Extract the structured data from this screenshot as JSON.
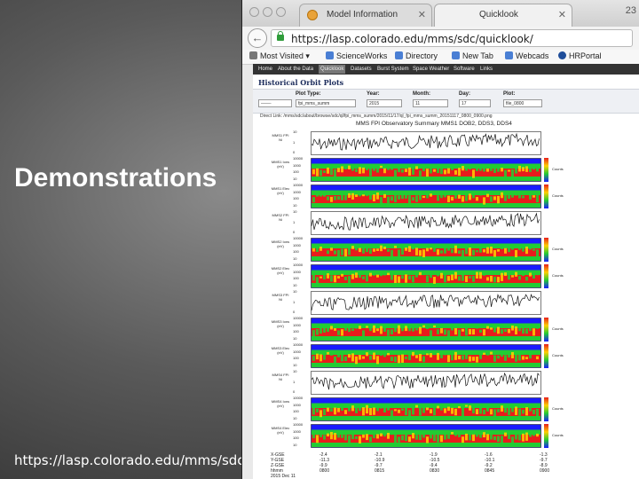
{
  "slide": {
    "title": "Demonstrations",
    "url": "https://lasp.colorado.edu/mms/sdc/"
  },
  "browser": {
    "tabs": [
      {
        "label": "Model Information",
        "active": false
      },
      {
        "label": "Quicklook",
        "active": true
      }
    ],
    "window_number": "23",
    "address": "https://lasp.colorado.edu/mms/sdc/quicklook/",
    "bookmarks": [
      {
        "label": "Most Visited",
        "icon": "gear-icon"
      },
      {
        "label": "ScienceWorks",
        "icon": "folder-icon"
      },
      {
        "label": "Directory",
        "icon": "folder-icon"
      },
      {
        "label": "New Tab",
        "icon": "folder-icon"
      },
      {
        "label": "Webcads",
        "icon": "folder-icon"
      },
      {
        "label": "HRPortal",
        "icon": "globe-icon"
      }
    ]
  },
  "site": {
    "menu": [
      "Home",
      "About the Data",
      "Quicklook",
      "Datasets",
      "Burst System",
      "Space Weather",
      "Software",
      "Links"
    ],
    "active_menu": "Quicklook",
    "section_title": "Historical Orbit Plots",
    "form": {
      "plot_type_label": "Plot Type:",
      "plot_type_value": "fpi_mms_summ",
      "observatory_value": "——-",
      "year_label": "Year:",
      "year_value": "2015",
      "month_label": "Month:",
      "month_value": "11",
      "day_label": "Day:",
      "day_value": "17",
      "plot_label": "Plot:",
      "plot_value": "file_0800"
    },
    "direct_link": "Direct Link: /mms/sdc/about/browse/sdc/ql/fpi_mms_summ/2015/11/17/ql_fpi_mms_summ_20151117_0800_0900.png"
  },
  "plot": {
    "title": "MMS FPI Observatory Summary  MMS1 DOB2, DDS3, DDS4",
    "panels": [
      {
        "kind": "line",
        "ylabel": "MMS1 FPI Ni",
        "ticks": [
          "10",
          "1",
          "0"
        ]
      },
      {
        "kind": "spec",
        "ylabel": "MMS1 Ions (eV)",
        "ticks": [
          "10000",
          "1000",
          "100",
          "10"
        ],
        "cbar": "Counts"
      },
      {
        "kind": "spec",
        "ylabel": "MMS1 Elec (eV)",
        "ticks": [
          "10000",
          "1000",
          "100",
          "10"
        ],
        "cbar": "Counts"
      },
      {
        "kind": "line",
        "ylabel": "MMS2 FPI Ni",
        "ticks": [
          "10",
          "1",
          "0"
        ]
      },
      {
        "kind": "spec",
        "ylabel": "MMS2 Ions (eV)",
        "ticks": [
          "10000",
          "1000",
          "100",
          "10"
        ],
        "cbar": "Counts"
      },
      {
        "kind": "spec",
        "ylabel": "MMS2 Elec (eV)",
        "ticks": [
          "10000",
          "1000",
          "100",
          "10"
        ],
        "cbar": "Counts"
      },
      {
        "kind": "line",
        "ylabel": "MMS3 FPI Ni",
        "ticks": [
          "10",
          "1",
          "0"
        ]
      },
      {
        "kind": "spec",
        "ylabel": "MMS3 Ions (eV)",
        "ticks": [
          "10000",
          "1000",
          "100",
          "10"
        ],
        "cbar": "Counts"
      },
      {
        "kind": "spec",
        "ylabel": "MMS3 Elec (eV)",
        "ticks": [
          "10000",
          "1000",
          "100",
          "10"
        ],
        "cbar": "Counts"
      },
      {
        "kind": "line",
        "ylabel": "MMS4 FPI Ni",
        "ticks": [
          "10",
          "1",
          "0"
        ]
      },
      {
        "kind": "spec",
        "ylabel": "MMS4 Ions (eV)",
        "ticks": [
          "10000",
          "1000",
          "100",
          "10"
        ],
        "cbar": "Counts"
      },
      {
        "kind": "spec",
        "ylabel": "MMS4 Elec (eV)",
        "ticks": [
          "10000",
          "1000",
          "100",
          "10"
        ],
        "cbar": "Counts"
      }
    ],
    "footer_rows": [
      "X-GSE",
      "Y-GSE",
      "Z-GSE",
      "hhmm",
      "2015 Dec 11"
    ],
    "footer_cols": [
      [
        "-2.4",
        "-11.3",
        "-9.9",
        "0800"
      ],
      [
        "-2.1",
        "-10.9",
        "-9.7",
        "0815"
      ],
      [
        "-1.9",
        "-10.5",
        "-9.4",
        "0830"
      ],
      [
        "-1.6",
        "-10.1",
        "-9.2",
        "0845"
      ],
      [
        "-1.3",
        "-9.7",
        "-8.9",
        "0900"
      ]
    ],
    "colors": {
      "line": "#111111",
      "spec_low": "#1a1aff",
      "spec_mid": "#22cc33",
      "spec_high": "#e81c1c",
      "spec_peak": "#ffd000"
    }
  }
}
